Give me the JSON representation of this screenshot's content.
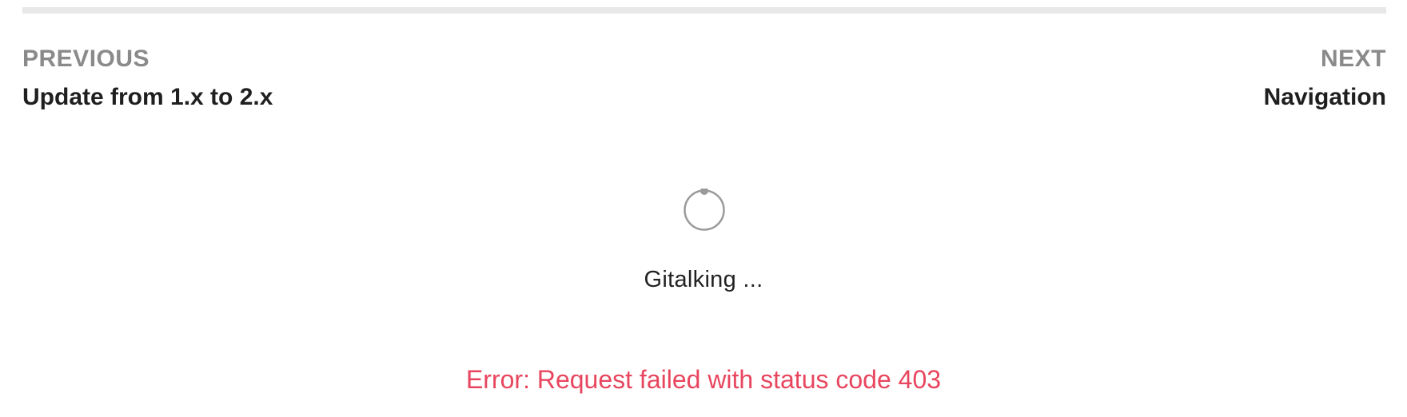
{
  "pagination": {
    "previous": {
      "kicker": "PREVIOUS",
      "title": "Update from 1.x to 2.x"
    },
    "next": {
      "kicker": "NEXT",
      "title": "Navigation"
    }
  },
  "comments": {
    "spinner_icon": "loading-spinner",
    "loading_text": "Gitalking ...",
    "error_text": "Error: Request failed with status code 403",
    "colors": {
      "error": "#e8465e",
      "spinner": "#9a9a9a",
      "divider": "#e8e8e8"
    }
  }
}
